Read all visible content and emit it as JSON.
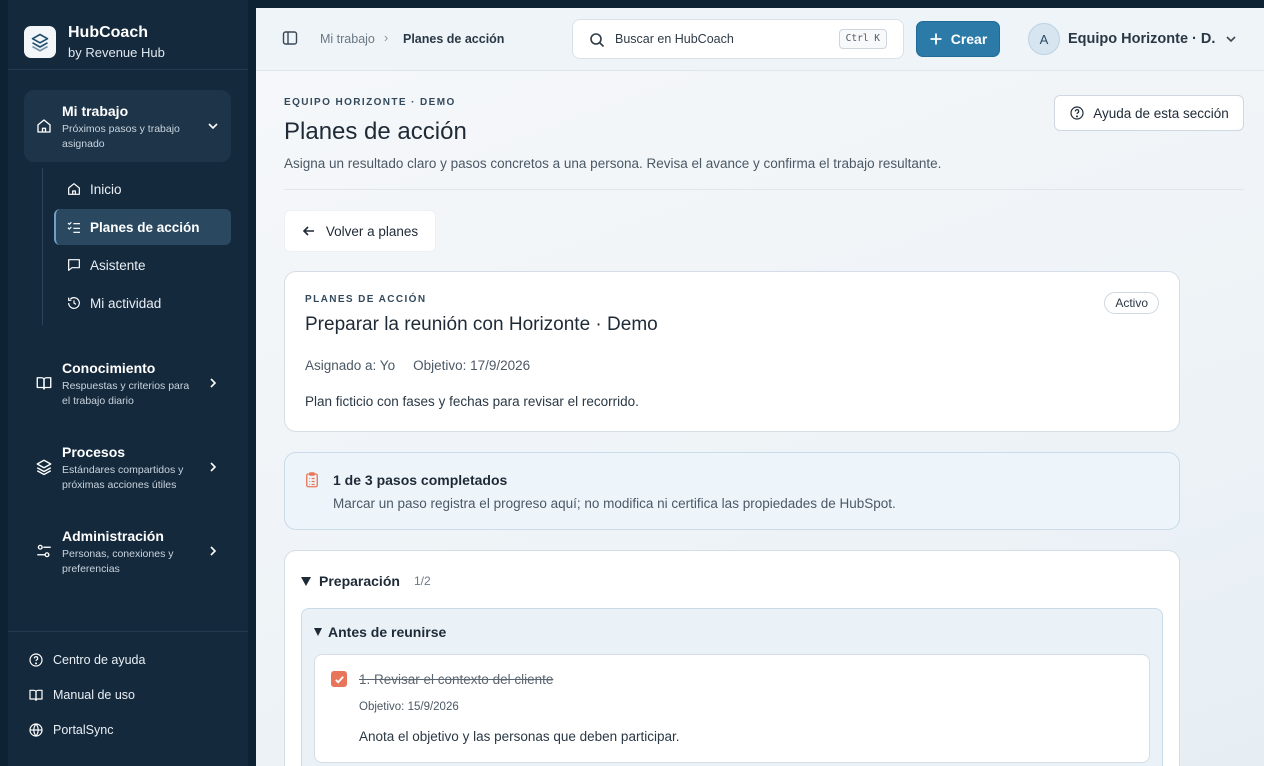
{
  "brand": {
    "name": "HubCoach",
    "sub": "by Revenue Hub"
  },
  "sidebar": {
    "groups": [
      {
        "title": "Mi trabajo",
        "desc": "Próximos pasos y trabajo asignado"
      },
      {
        "title": "Conocimiento",
        "desc": "Respuestas y criterios para el trabajo diario"
      },
      {
        "title": "Procesos",
        "desc": "Estándares compartidos y próximas acciones útiles"
      },
      {
        "title": "Administración",
        "desc": "Personas, conexiones y preferencias"
      }
    ],
    "sub_items": [
      {
        "label": "Inicio",
        "icon": "home-icon"
      },
      {
        "label": "Planes de acción",
        "icon": "checklist-icon"
      },
      {
        "label": "Asistente",
        "icon": "chat-icon"
      },
      {
        "label": "Mi actividad",
        "icon": "history-icon"
      }
    ],
    "footer": [
      {
        "label": "Centro de ayuda",
        "icon": "help-circle-icon"
      },
      {
        "label": "Manual de uso",
        "icon": "book-open-icon"
      },
      {
        "label": "PortalSync",
        "icon": "globe-icon"
      }
    ]
  },
  "topbar": {
    "breadcrumb": [
      "Mi trabajo",
      "Planes de acción"
    ],
    "search_label": "Buscar en HubCoach",
    "search_shortcut": "Ctrl K",
    "create_label": "Crear",
    "avatar_initial": "A",
    "team_name": "Equipo Horizonte · D..."
  },
  "page": {
    "eyebrow": "EQUIPO HORIZONTE · DEMO",
    "title": "Planes de acción",
    "description": "Asigna un resultado claro y pasos concretos a una persona. Revisa el avance y confirma el trabajo resultante.",
    "help_label": "Ayuda de esta sección",
    "back_label": "Volver a planes"
  },
  "plan": {
    "eyebrow": "PLANES DE ACCIÓN",
    "title": "Preparar la reunión con Horizonte · Demo",
    "status": "Activo",
    "assigned": "Asignado a: Yo",
    "objective": "Objetivo: 17/9/2026",
    "description": "Plan ficticio con fases y fechas para revisar el recorrido."
  },
  "progress": {
    "title": "1 de 3 pasos completados",
    "description": "Marcar un paso registra el progreso aquí; no modifica ni certifica las propiedades de HubSpot."
  },
  "section": {
    "name": "Preparación",
    "count": "1/2",
    "subsection": "Antes de reunirse",
    "step": {
      "title": "1. Revisar el contexto del cliente",
      "objective": "Objetivo: 15/9/2026",
      "description": "Anota el objetivo y las personas que deben participar.",
      "completed": true
    }
  },
  "colors": {
    "sidebar": "#15293c",
    "accent": "#2b7aa8",
    "check": "#e8755a"
  }
}
